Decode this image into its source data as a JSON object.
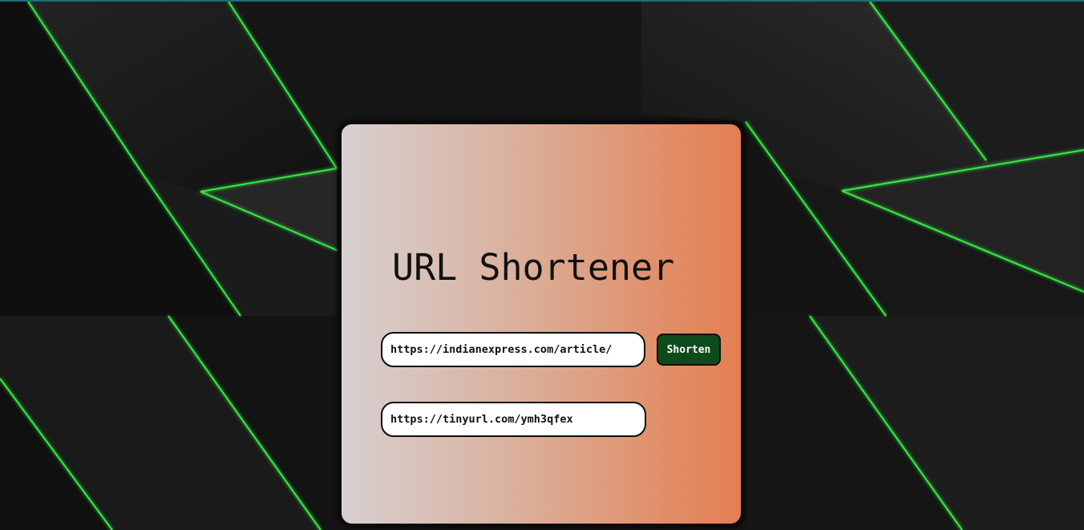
{
  "app": {
    "title": "URL Shortener"
  },
  "form": {
    "long_url_value": "https://indianexpress.com/article/",
    "shorten_label": "Shorten",
    "short_url_value": "https://tinyurl.com/ymh3qfex"
  },
  "colors": {
    "button_bg": "#0d4b1d",
    "card_gradient_start": "#d7d0d1",
    "card_gradient_end": "#e47e52",
    "background": "#141414",
    "accent_glow": "#39ff4a"
  }
}
